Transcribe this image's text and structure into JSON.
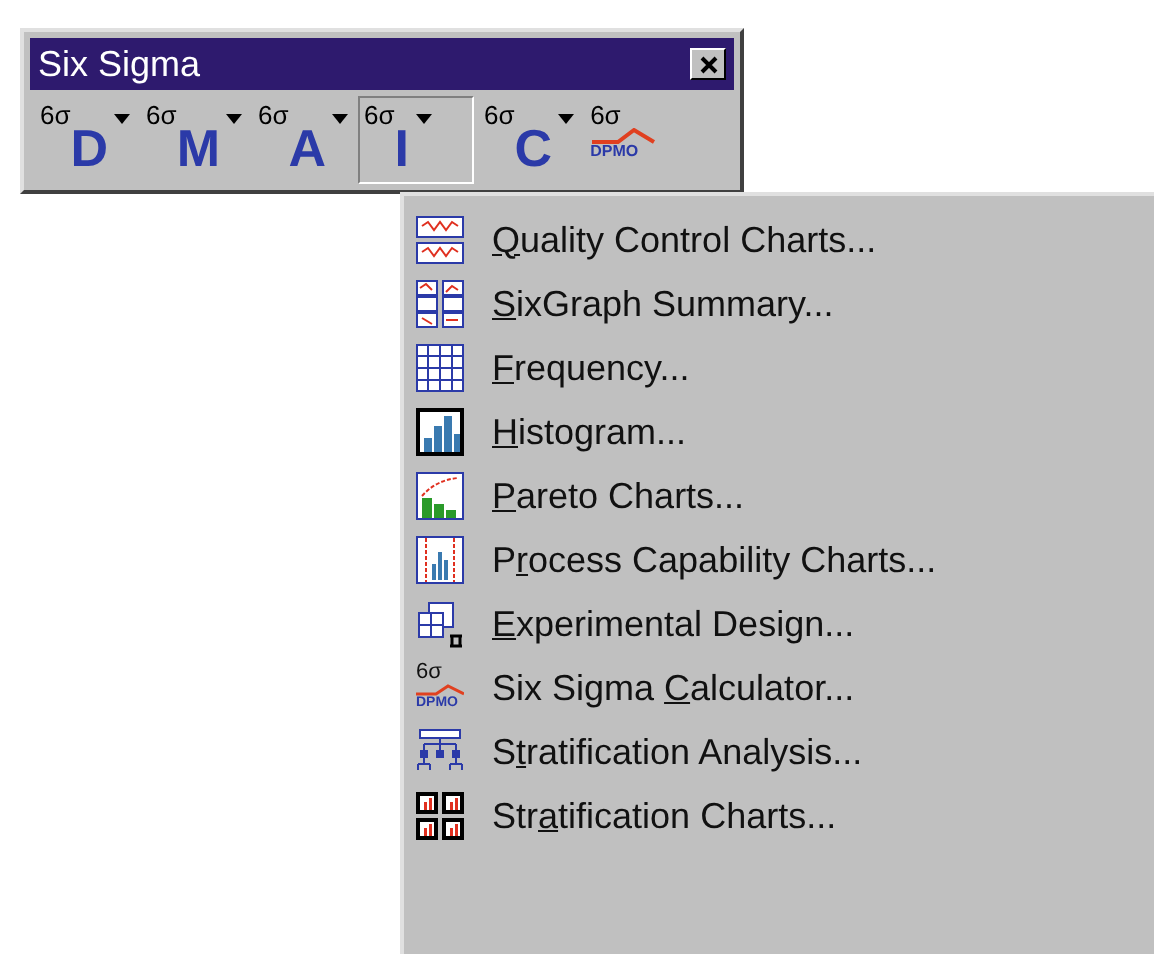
{
  "window": {
    "title": "Six Sigma"
  },
  "toolbar": [
    {
      "kind": "phase",
      "sigma": "6σ",
      "letter": "D",
      "selected": false
    },
    {
      "kind": "phase",
      "sigma": "6σ",
      "letter": "M",
      "selected": false
    },
    {
      "kind": "phase",
      "sigma": "6σ",
      "letter": "A",
      "selected": false
    },
    {
      "kind": "phase",
      "sigma": "6σ",
      "letter": "I",
      "selected": true
    },
    {
      "kind": "phase",
      "sigma": "6σ",
      "letter": "C",
      "selected": false
    },
    {
      "kind": "dpmo",
      "sigma": "6σ",
      "letter": "DPMO",
      "selected": false
    }
  ],
  "menu": [
    {
      "mnemonic": "Q",
      "after": "uality Control Charts..."
    },
    {
      "mnemonic": "S",
      "after": "ixGraph Summary..."
    },
    {
      "mnemonic": "F",
      "after": "requency..."
    },
    {
      "mnemonic": "H",
      "after": "istogram..."
    },
    {
      "mnemonic": "P",
      "after": "areto Charts..."
    },
    {
      "before": "P",
      "mnemonic": "r",
      "after": "ocess Capability Charts..."
    },
    {
      "mnemonic": "E",
      "after": "xperimental Design..."
    },
    {
      "sigma": "6σ",
      "caption": "DPMO",
      "before": "Six Sigma ",
      "mnemonic": "C",
      "after": "alculator..."
    },
    {
      "before": "S",
      "mnemonic": "t",
      "after": "ratification Analysis..."
    },
    {
      "before": "Str",
      "mnemonic": "a",
      "after": "tification Charts..."
    }
  ]
}
